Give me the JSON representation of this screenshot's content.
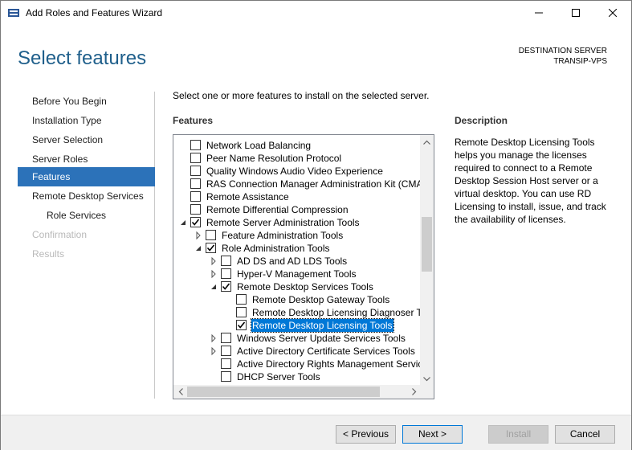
{
  "window": {
    "title": "Add Roles and Features Wizard",
    "controls": {
      "minimize": "minimize",
      "maximize": "maximize",
      "close": "close"
    }
  },
  "header": {
    "page_title": "Select features",
    "destination_label": "DESTINATION SERVER",
    "destination_name": "TRANSIP-VPS"
  },
  "nav": {
    "items": [
      {
        "label": "Before You Begin",
        "state": "normal"
      },
      {
        "label": "Installation Type",
        "state": "normal"
      },
      {
        "label": "Server Selection",
        "state": "normal"
      },
      {
        "label": "Server Roles",
        "state": "normal"
      },
      {
        "label": "Features",
        "state": "active"
      },
      {
        "label": "Remote Desktop Services",
        "state": "normal"
      },
      {
        "label": "Role Services",
        "state": "sub"
      },
      {
        "label": "Confirmation",
        "state": "disabled"
      },
      {
        "label": "Results",
        "state": "disabled"
      }
    ]
  },
  "main": {
    "instruction": "Select one or more features to install on the selected server.",
    "features_heading": "Features",
    "description_heading": "Description",
    "description_text": "Remote Desktop Licensing Tools helps you manage the licenses required to connect to a Remote Desktop Session Host server or a virtual desktop. You can use RD Licensing to install, issue, and track the availability of licenses."
  },
  "features_tree": [
    {
      "label": "Network Load Balancing",
      "level": 0,
      "expander": "none",
      "checked": false
    },
    {
      "label": "Peer Name Resolution Protocol",
      "level": 0,
      "expander": "none",
      "checked": false
    },
    {
      "label": "Quality Windows Audio Video Experience",
      "level": 0,
      "expander": "none",
      "checked": false
    },
    {
      "label": "RAS Connection Manager Administration Kit (CMA",
      "level": 0,
      "expander": "none",
      "checked": false
    },
    {
      "label": "Remote Assistance",
      "level": 0,
      "expander": "none",
      "checked": false
    },
    {
      "label": "Remote Differential Compression",
      "level": 0,
      "expander": "none",
      "checked": false
    },
    {
      "label": "Remote Server Administration Tools",
      "level": 0,
      "expander": "expanded",
      "checked": true
    },
    {
      "label": "Feature Administration Tools",
      "level": 1,
      "expander": "collapsed",
      "checked": false
    },
    {
      "label": "Role Administration Tools",
      "level": 1,
      "expander": "expanded",
      "checked": true
    },
    {
      "label": "AD DS and AD LDS Tools",
      "level": 2,
      "expander": "collapsed",
      "checked": false
    },
    {
      "label": "Hyper-V Management Tools",
      "level": 2,
      "expander": "collapsed",
      "checked": false
    },
    {
      "label": "Remote Desktop Services Tools",
      "level": 2,
      "expander": "expanded",
      "checked": true
    },
    {
      "label": "Remote Desktop Gateway Tools",
      "level": 3,
      "expander": "none",
      "checked": false
    },
    {
      "label": "Remote Desktop Licensing Diagnoser To",
      "level": 3,
      "expander": "none",
      "checked": false
    },
    {
      "label": "Remote Desktop Licensing Tools",
      "level": 3,
      "expander": "none",
      "checked": true,
      "selected": true
    },
    {
      "label": "Windows Server Update Services Tools",
      "level": 2,
      "expander": "collapsed",
      "checked": false
    },
    {
      "label": "Active Directory Certificate Services Tools",
      "level": 2,
      "expander": "collapsed",
      "checked": false
    },
    {
      "label": "Active Directory Rights Management Servic",
      "level": 2,
      "expander": "none",
      "checked": false
    },
    {
      "label": "DHCP Server Tools",
      "level": 2,
      "expander": "none",
      "checked": false
    }
  ],
  "footer": {
    "previous": "< Previous",
    "next": "Next >",
    "install": "Install",
    "cancel": "Cancel"
  },
  "colors": {
    "accent": "#2c72b9",
    "title_blue": "#1f5f8b",
    "selection": "#0078d7"
  }
}
